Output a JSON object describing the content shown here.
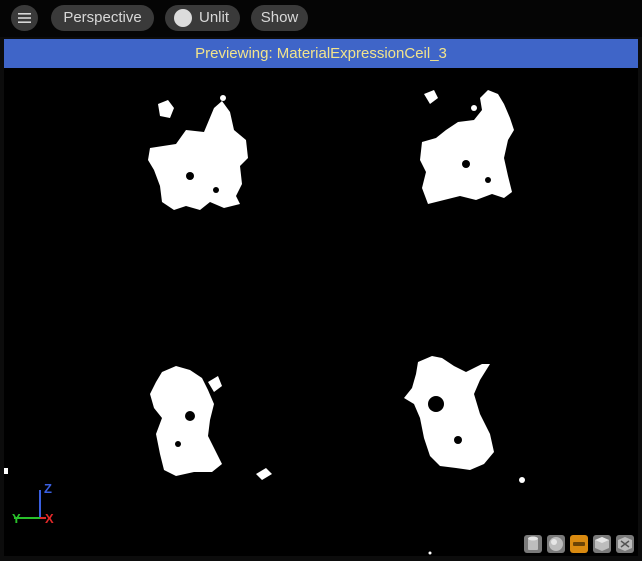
{
  "toolbar": {
    "menu_icon": "hamburger-icon",
    "perspective_label": "Perspective",
    "lighting_label": "Unlit",
    "lighting_icon": "sphere-icon",
    "show_label": "Show"
  },
  "banner": {
    "text": "Previewing: MaterialExpressionCeil_3",
    "color": "#3f65c8",
    "text_color": "#f2e48c"
  },
  "gizmo": {
    "z_label": "Z",
    "x_label": "X",
    "y_label": "Y"
  },
  "preview_shapes": [
    {
      "name": "cylinder",
      "icon": "cylinder-icon"
    },
    {
      "name": "sphere",
      "icon": "sphere-icon"
    },
    {
      "name": "plane",
      "icon": "plane-icon",
      "active": true
    },
    {
      "name": "cube",
      "icon": "cube-icon"
    },
    {
      "name": "custom-mesh",
      "icon": "teapot-icon"
    }
  ],
  "colors": {
    "accent": "#1e8fff",
    "active_shape": "#d98a10",
    "axis_x": "#e02828",
    "axis_y": "#28c02a",
    "axis_z": "#3a5fe0"
  }
}
